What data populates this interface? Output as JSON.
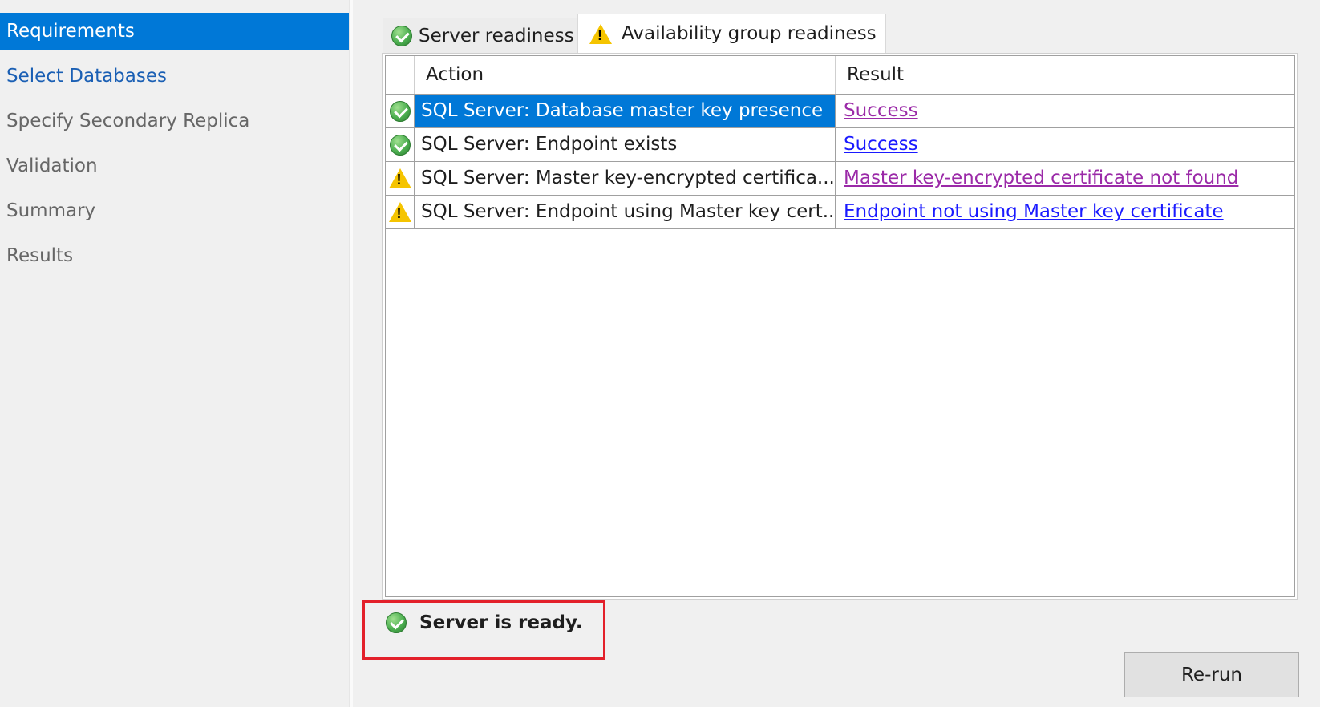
{
  "sidebar": {
    "items": [
      {
        "label": "Requirements"
      },
      {
        "label": "Select Databases"
      },
      {
        "label": "Specify Secondary Replica"
      },
      {
        "label": "Validation"
      },
      {
        "label": "Summary"
      },
      {
        "label": "Results"
      }
    ]
  },
  "tabs": [
    {
      "label": "Server readiness",
      "icon": "check-circle"
    },
    {
      "label": "Availability group readiness",
      "icon": "warning-triangle"
    }
  ],
  "grid": {
    "columns": [
      "Action",
      "Result"
    ],
    "rows": [
      {
        "status": "success",
        "action": "SQL Server: Database master key presence",
        "result": "Success"
      },
      {
        "status": "success",
        "action": "SQL Server: Endpoint exists",
        "result": "Success"
      },
      {
        "status": "warning",
        "action": "SQL Server: Master key-encrypted certifica...",
        "result": "Master key-encrypted certificate not found"
      },
      {
        "status": "warning",
        "action": "SQL Server: Endpoint using Master key cert...",
        "result": "Endpoint not using Master key certificate"
      }
    ]
  },
  "status": {
    "text": "Server is ready."
  },
  "buttons": {
    "rerun": "Re-run"
  },
  "colors": {
    "selection": "#0078d7",
    "visited_link": "#9b2aa8",
    "link": "#1a1aff",
    "highlight_border": "#e3202a",
    "warning": "#f5c400",
    "success": "#4caf50"
  }
}
